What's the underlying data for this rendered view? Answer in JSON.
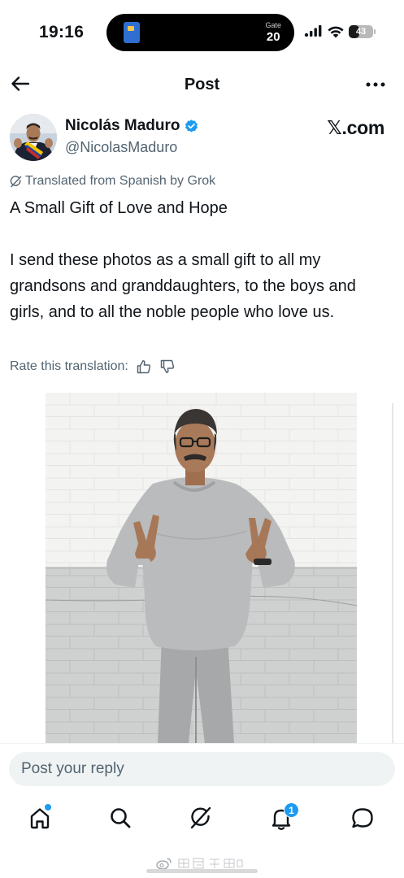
{
  "status_bar": {
    "time": "19:16",
    "live_activity": {
      "gate_label": "Gate",
      "gate_number": "20",
      "card_icon": "transit-card-icon"
    },
    "battery_percent": "43",
    "battery_level": 0.43
  },
  "header": {
    "title": "Post",
    "back_icon": "arrow-left-icon",
    "more_icon": "more-dots-icon"
  },
  "post": {
    "author_name": "Nicolás Maduro",
    "author_handle": "@NicolasMaduro",
    "verified": true,
    "source_label": "𝕏.com",
    "translated_notice": "Translated from Spanish by Grok",
    "title": "A Small Gift of Love and Hope",
    "body": "I send these photos as a small gift to all my grandsons and granddaughters, to the boys and girls, and to all the noble people who love us.",
    "rate_label": "Rate this translation:"
  },
  "reply": {
    "placeholder": "Post your reply"
  },
  "tabbar": {
    "items": [
      {
        "name": "home",
        "icon": "home-icon",
        "has_dot": true
      },
      {
        "name": "search",
        "icon": "search-icon"
      },
      {
        "name": "grok",
        "icon": "grok-icon"
      },
      {
        "name": "notifications",
        "icon": "bell-icon",
        "badge": "1"
      },
      {
        "name": "messages",
        "icon": "message-icon"
      }
    ]
  },
  "colors": {
    "accent": "#1d9bf0",
    "text": "#0f1419",
    "secondary": "#536471"
  }
}
